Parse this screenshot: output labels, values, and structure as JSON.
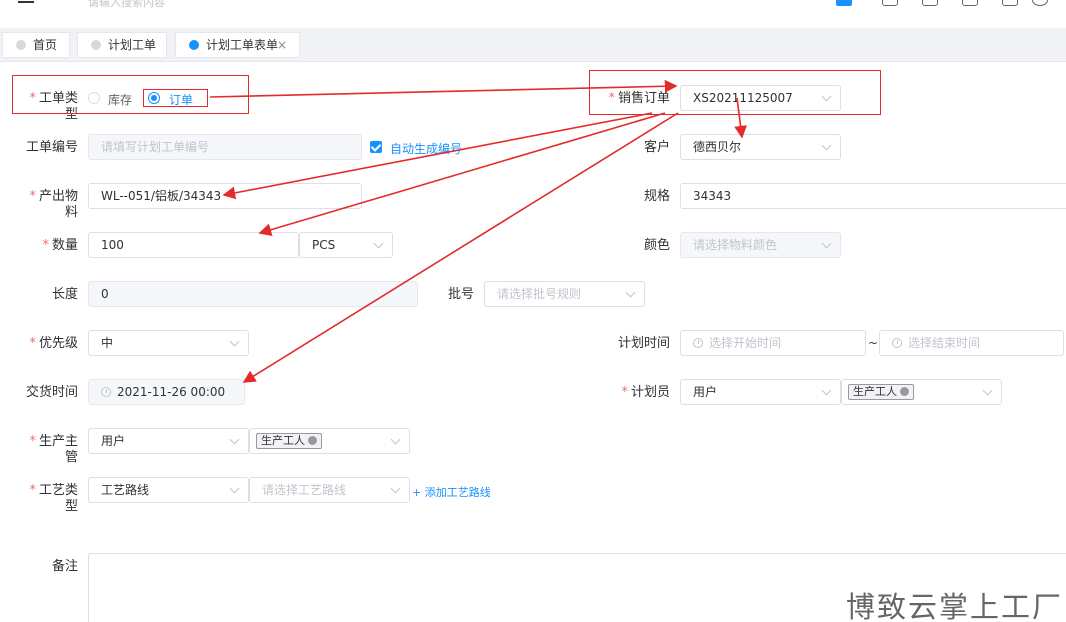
{
  "topbar": {
    "search_placeholder": "请输入搜索内容"
  },
  "tabs": [
    {
      "label": "首页",
      "active": false
    },
    {
      "label": "计划工单",
      "active": false
    },
    {
      "label": "计划工单表单",
      "active": true,
      "close": "×"
    }
  ],
  "form": {
    "order_type": {
      "label": "工单类型",
      "options": [
        "库存",
        "订单"
      ],
      "selected": "订单"
    },
    "sales_order": {
      "label": "销售订单",
      "value": "XS20211125007"
    },
    "order_no": {
      "label": "工单编号",
      "placeholder": "请填写计划工单编号",
      "auto_label": "自动生成编号"
    },
    "customer": {
      "label": "客户",
      "value": "德西贝尔"
    },
    "material": {
      "label": "产出物料",
      "value": "WL--051/铝板/34343"
    },
    "spec": {
      "label": "规格",
      "value": "34343"
    },
    "quantity": {
      "label": "数量",
      "value": "100",
      "unit": "PCS"
    },
    "color": {
      "label": "颜色",
      "placeholder": "请选择物料颜色"
    },
    "length": {
      "label": "长度",
      "value": "0"
    },
    "batch": {
      "label": "批号",
      "placeholder": "请选择批号规则"
    },
    "priority": {
      "label": "优先级",
      "value": "中"
    },
    "plan_time": {
      "label": "计划时间",
      "start_placeholder": "选择开始时间",
      "separator": "~",
      "end_placeholder": "选择结束时间"
    },
    "delivery_time": {
      "label": "交货时间",
      "value": "2021-11-26 00:00"
    },
    "planner": {
      "label": "计划员",
      "type": "用户",
      "tag": "生产工人"
    },
    "supervisor": {
      "label": "生产主管",
      "type": "用户",
      "tag": "生产工人"
    },
    "process_type": {
      "label": "工艺类型",
      "value": "工艺路线",
      "route_placeholder": "请选择工艺路线",
      "add_link": "+ 添加工艺路线"
    },
    "remark": {
      "label": "备注"
    }
  },
  "watermark": "博致云掌上工厂",
  "colors": {
    "accent": "#1890ff",
    "required": "#f56c6c",
    "annotation": "#e32b2b"
  }
}
